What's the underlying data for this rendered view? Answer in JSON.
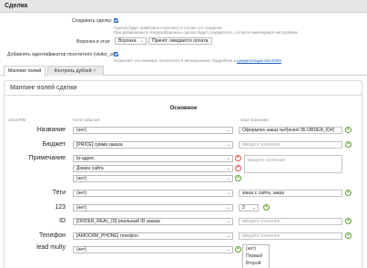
{
  "header": {
    "title": "Сделка"
  },
  "settings": {
    "create_deal_label": "Создавать сделку:",
    "create_deal_hint_1": "Сделка будет привязана к контакту в случае его создания.",
    "create_deal_hint_2": "При добавлении в «Неразобранное» сделка будет создаваться, согласно имеющимся настройкам.",
    "pipeline_label": "Воронка и этап",
    "pipeline_value": "Воронка",
    "stage_value": "Принят, ожидается оплата",
    "visitor_uid_label": "Добавлять идентификатор посетителя (visitor_uid)",
    "visitor_uid_hint": "Позволяет отслеживать посетителя в автоворонках. Подробнее в",
    "visitor_uid_link": "документации amoCRM"
  },
  "tabs": [
    {
      "label": "Маппинг полей"
    },
    {
      "label": "Контроль дублей ✓"
    }
  ],
  "panel": {
    "title": "Маппинг полей сделки"
  },
  "section": {
    "title": "Основное"
  },
  "columns": {
    "amo": "amoCRM",
    "event": "поле события",
    "own": "свое значение"
  },
  "fields": [
    {
      "label": "Название",
      "select": "(нет)",
      "value": "Оформлен заказ №#{event 95.ORDER_ID#}",
      "value_is_placeholder": false
    },
    {
      "label": "Бюджет",
      "select": "[PRICE] сумма заказа",
      "value": "введите значение",
      "value_is_placeholder": true
    },
    {
      "label": "Примечание",
      "selects": [
        "Ip-адрес",
        "Домен сайта",
        "(нет)"
      ],
      "value": "введите значение"
    },
    {
      "label": "Теги",
      "select": "(нет)",
      "value": "заказ с сайта, заказ",
      "value_is_placeholder": false
    },
    {
      "label": "123",
      "select": "(нет)",
      "value": "3"
    },
    {
      "label": "ID",
      "select": "[ORDER_REAL_ID] реальный ID заказа",
      "value": "введите значение",
      "value_is_placeholder": true
    },
    {
      "label": "Телефон",
      "select": "[AMOCRM_PHONE] телефон",
      "value": "введите значение",
      "value_is_placeholder": true
    },
    {
      "label": "lead multy",
      "select": "(нет)",
      "options": [
        "(нет)",
        "Первый",
        "Второй"
      ]
    }
  ],
  "colors": {
    "accent": "#2f6fd6",
    "add": "#5aa02c",
    "remove": "#d9534f"
  },
  "icons": {
    "add": "plus-circle-icon",
    "remove": "x-circle-icon",
    "dropdown": "chevron-down-icon"
  }
}
